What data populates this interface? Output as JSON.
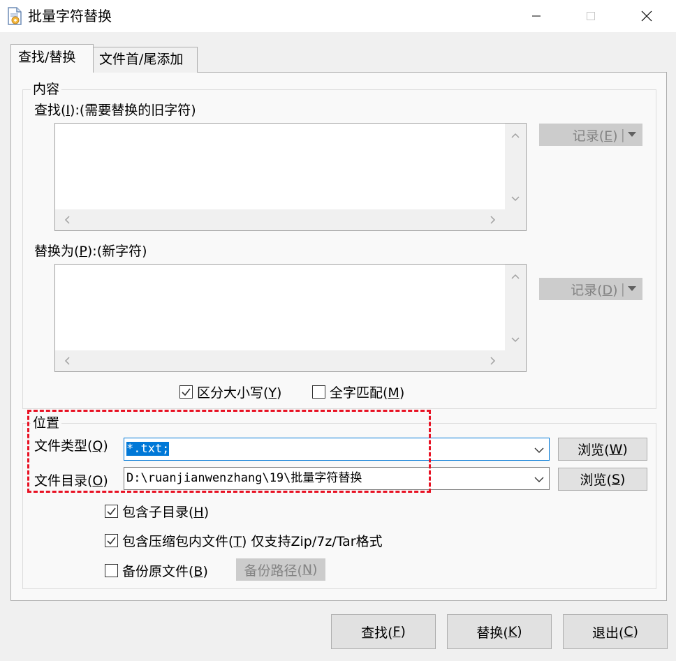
{
  "window": {
    "title": "批量字符替换"
  },
  "tabs": [
    {
      "label": "查找/替换",
      "active": true
    },
    {
      "label": "文件首/尾添加",
      "active": false
    }
  ],
  "content_group": {
    "legend": "内容",
    "find_label_pre": "查找(",
    "find_label_key": "I",
    "find_label_post": "):(需要替换的旧字符)",
    "find_text": "",
    "find_record": {
      "pre": "记录(",
      "key": "E",
      "post": ")"
    },
    "replace_label_pre": "替换为(",
    "replace_label_key": "P",
    "replace_label_post": "):(新字符)",
    "replace_text": "",
    "replace_record": {
      "pre": "记录(",
      "key": "D",
      "post": ")"
    },
    "case_sensitive": {
      "pre": "区分大小写(",
      "key": "Y",
      "post": ")",
      "checked": true
    },
    "whole_word": {
      "pre": "全字匹配(",
      "key": "M",
      "post": ")",
      "checked": false
    }
  },
  "location_group": {
    "legend": "位置",
    "file_type_label": {
      "pre": "文件类型(",
      "key": "Q",
      "post": ")"
    },
    "file_type_value": "*.txt;",
    "file_dir_label": {
      "pre": "文件目录(",
      "key": "O",
      "post": ")"
    },
    "file_dir_value": "D:\\ruanjianwenzhang\\19\\批量字符替换",
    "browse_type": {
      "pre": "浏览(",
      "key": "W",
      "post": ")"
    },
    "browse_dir": {
      "pre": "浏览(",
      "key": "S",
      "post": ")"
    },
    "include_subdirs": {
      "pre": "包含子目录(",
      "key": "H",
      "post": ")",
      "checked": true
    },
    "include_archives": {
      "pre": "包含压缩包内文件(",
      "key": "T",
      "post": ") 仅支持Zip/7z/Tar格式",
      "checked": true
    },
    "backup_originals": {
      "pre": "备份原文件(",
      "key": "B",
      "post": ")",
      "checked": false
    },
    "backup_path": {
      "pre": "备份路径(",
      "key": "N",
      "post": ")"
    }
  },
  "footer": {
    "find": {
      "pre": "查找(",
      "key": "F",
      "post": ")"
    },
    "replace": {
      "pre": "替换(",
      "key": "K",
      "post": ")"
    },
    "exit": {
      "pre": "退出(",
      "key": "C",
      "post": ")"
    }
  },
  "colors": {
    "accent": "#0078d7",
    "highlight": "#e81123"
  }
}
